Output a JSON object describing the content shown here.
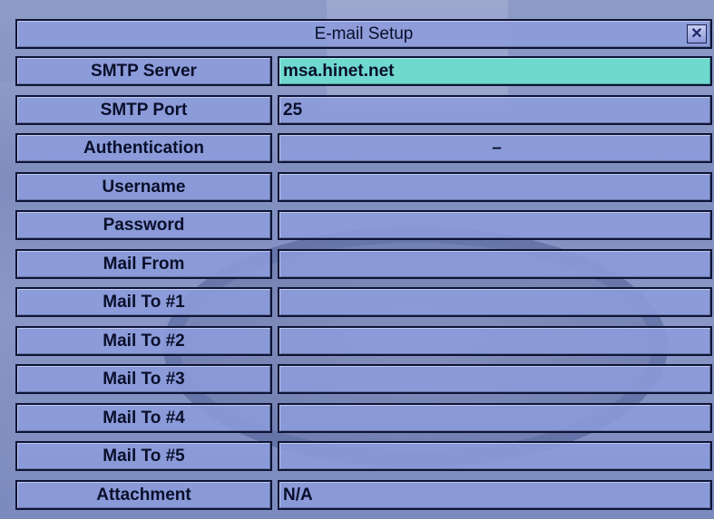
{
  "dialog": {
    "title": "E-mail Setup",
    "close_glyph": "✕"
  },
  "fields": [
    {
      "label": "SMTP Server",
      "value": "msa.hinet.net"
    },
    {
      "label": "SMTP Port",
      "value": "25"
    },
    {
      "label": "Authentication",
      "value": "–"
    },
    {
      "label": "Username",
      "value": ""
    },
    {
      "label": "Password",
      "value": ""
    },
    {
      "label": "Mail From",
      "value": ""
    },
    {
      "label": "Mail To #1",
      "value": ""
    },
    {
      "label": "Mail To #2",
      "value": ""
    },
    {
      "label": "Mail To #3",
      "value": ""
    },
    {
      "label": "Mail To #4",
      "value": ""
    },
    {
      "label": "Mail To #5",
      "value": ""
    },
    {
      "label": "Attachment",
      "value": "N/A"
    }
  ],
  "colors": {
    "active_field": "#6fd9cf",
    "cell": "#8c9cdc",
    "border": "#0d1436"
  }
}
